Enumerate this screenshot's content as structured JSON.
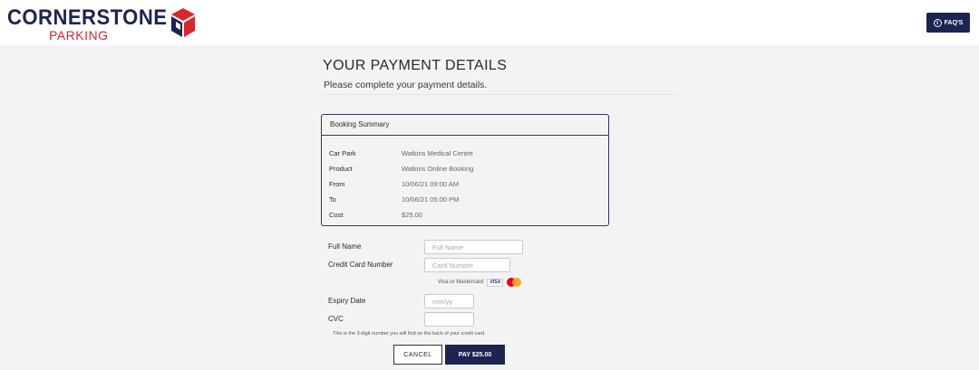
{
  "header": {
    "logo_main": "CORNERSTONE",
    "logo_sub": "PARKING",
    "faq_label": "FAQ'S",
    "faq_icon": "info-icon"
  },
  "page": {
    "title": "YOUR PAYMENT DETAILS",
    "subtitle": "Please complete your payment details."
  },
  "booking_summary": {
    "heading": "Booking Summary",
    "rows": [
      {
        "label": "Car Park",
        "value": "Watkins Medical Centre"
      },
      {
        "label": "Product",
        "value": "Watkins Online Booking"
      },
      {
        "label": "From",
        "value": "10/06/21 09:00 AM"
      },
      {
        "label": "To",
        "value": "10/06/21 05:00 PM"
      },
      {
        "label": "Cost",
        "value": "$25.00"
      }
    ]
  },
  "form": {
    "full_name": {
      "label": "Full Name",
      "placeholder": "Full Name",
      "value": ""
    },
    "card_number": {
      "label": "Credit Card Number",
      "placeholder": "Card Number",
      "value": ""
    },
    "card_types_note": "Visa or Mastercard",
    "visa_text": "VISA",
    "expiry": {
      "label": "Expiry Date",
      "placeholder": "mm/yy",
      "value": ""
    },
    "cvc": {
      "label": "CVC",
      "placeholder": "",
      "value": ""
    },
    "cvc_help": "This is the 3-digit number you will find on the back of your credit card."
  },
  "actions": {
    "cancel_label": "CANCEL",
    "pay_label": "PAY $25.00"
  },
  "colors": {
    "brand_navy": "#1d2452",
    "brand_red": "#d8272f",
    "page_bg": "#f3f3f3"
  }
}
